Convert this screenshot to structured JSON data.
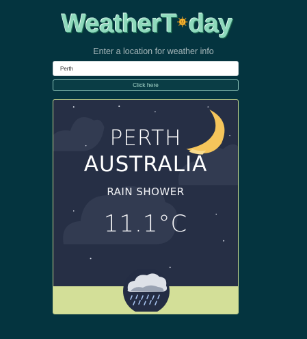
{
  "app": {
    "logo_text_before": "WeatherT",
    "logo_text_after": "day",
    "logo_icon": "sun-icon",
    "subtitle": "Enter a location for weather info"
  },
  "search": {
    "value": "Perth",
    "button_label": "Click here"
  },
  "weather": {
    "city": "PERTH",
    "country": "AUSTRALIA",
    "condition": "RAIN SHOWER",
    "temperature": "11.1°C",
    "sky_icon": "crescent-moon-icon",
    "condition_icon": "rain-cloud-icon"
  },
  "colors": {
    "background": "#04343f",
    "logo": "#8fd9bc",
    "card_sky": "#262f45",
    "card_ground": "#d3df98",
    "moon": "#f5c55b"
  }
}
